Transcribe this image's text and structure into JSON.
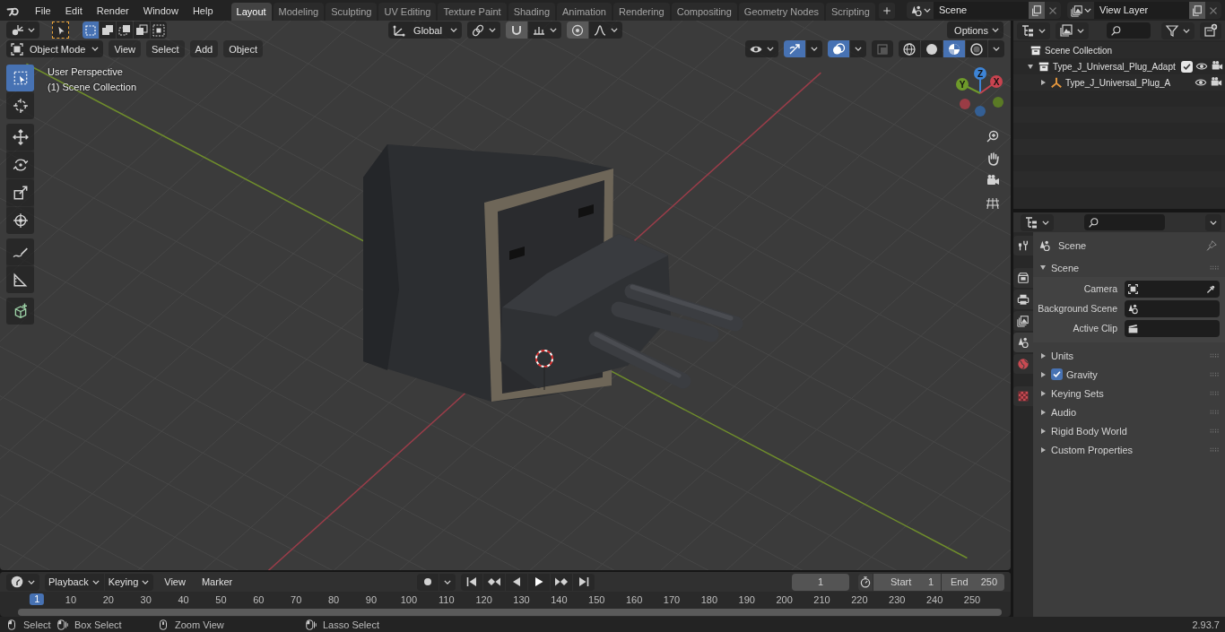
{
  "menu": [
    "File",
    "Edit",
    "Render",
    "Window",
    "Help"
  ],
  "workspaces": [
    {
      "label": "Layout",
      "selected": true
    },
    {
      "label": "Modeling",
      "selected": false
    },
    {
      "label": "Sculpting",
      "selected": false
    },
    {
      "label": "UV Editing",
      "selected": false
    },
    {
      "label": "Texture Paint",
      "selected": false
    },
    {
      "label": "Shading",
      "selected": false
    },
    {
      "label": "Animation",
      "selected": false
    },
    {
      "label": "Rendering",
      "selected": false
    },
    {
      "label": "Compositing",
      "selected": false
    },
    {
      "label": "Geometry Nodes",
      "selected": false
    },
    {
      "label": "Scripting",
      "selected": false
    }
  ],
  "scene_selector": {
    "value": "Scene"
  },
  "view_layer_selector": {
    "value": "View Layer"
  },
  "viewport": {
    "select_modes": [
      {
        "selected": true
      },
      {
        "selected": false
      },
      {
        "selected": false
      },
      {
        "selected": false
      },
      {
        "selected": false
      }
    ],
    "transform_orientation": "Global",
    "options": "Options",
    "mode": "Object Mode",
    "menus": [
      "View",
      "Select",
      "Add",
      "Object"
    ],
    "overlay_lines": [
      "User Perspective",
      "(1) Scene Collection"
    ],
    "tool_groups": [
      [
        {
          "kind": "select",
          "selected": true
        },
        {
          "kind": "cursor",
          "selected": false
        }
      ],
      [
        {
          "kind": "move",
          "selected": false
        },
        {
          "kind": "rotate",
          "selected": false
        },
        {
          "kind": "scale",
          "selected": false
        },
        {
          "kind": "transform",
          "selected": false
        }
      ],
      [
        {
          "kind": "annotate",
          "selected": false
        },
        {
          "kind": "measure",
          "selected": false
        }
      ],
      [
        {
          "kind": "add-cube",
          "selected": false
        }
      ]
    ],
    "gizmos_on": true,
    "overlays_on": true,
    "xray_on": false,
    "shading_modes": [
      {
        "kind": "wireframe",
        "selected": false
      },
      {
        "kind": "solid",
        "selected": false
      },
      {
        "kind": "material",
        "selected": true
      },
      {
        "kind": "rendered",
        "selected": false
      }
    ],
    "gizmo_axes": [
      {
        "label": "Z"
      },
      {
        "label": "Y"
      },
      {
        "label": "X"
      }
    ]
  },
  "outliner": {
    "root": "Scene Collection",
    "items": [
      {
        "label": "Type_J_Universal_Plug_Adapt",
        "kind": "collection",
        "expanded": true,
        "checked": true,
        "children": [
          {
            "label": "Type_J_Universal_Plug_A",
            "kind": "empty",
            "expanded": false
          }
        ]
      }
    ]
  },
  "properties": {
    "tabs": [
      {
        "kind": "tool",
        "selected": false
      },
      {
        "kind": "render",
        "selected": false
      },
      {
        "kind": "output",
        "selected": false
      },
      {
        "kind": "view-layer",
        "selected": false
      },
      {
        "kind": "scene",
        "selected": true
      },
      {
        "kind": "world",
        "selected": false
      },
      {
        "kind": "texture",
        "selected": false
      }
    ],
    "context": "Scene",
    "panels": [
      {
        "title": "Scene",
        "expanded": true,
        "fields": [
          {
            "label": "Camera",
            "kind": "camera"
          },
          {
            "label": "Background Scene",
            "kind": "scene"
          },
          {
            "label": "Active Clip",
            "kind": "clip"
          }
        ]
      },
      {
        "title": "Units",
        "expanded": false
      },
      {
        "title": "Gravity",
        "expanded": false,
        "checked": true
      },
      {
        "title": "Keying Sets",
        "expanded": false
      },
      {
        "title": "Audio",
        "expanded": false
      },
      {
        "title": "Rigid Body World",
        "expanded": false
      },
      {
        "title": "Custom Properties",
        "expanded": false
      }
    ]
  },
  "timeline": {
    "menus": [
      {
        "label": "Playback",
        "kind": "dropdown"
      },
      {
        "label": "Keying",
        "kind": "dropdown"
      },
      {
        "label": "View",
        "kind": "menu"
      },
      {
        "label": "Marker",
        "kind": "menu"
      }
    ],
    "current_frame": "1",
    "start_label": "Start",
    "start": "1",
    "end_label": "End",
    "end": "250",
    "ruler": [
      {
        "label": "1",
        "selected": true
      },
      {
        "label": "10",
        "selected": false
      },
      {
        "label": "20",
        "selected": false
      },
      {
        "label": "30",
        "selected": false
      },
      {
        "label": "40",
        "selected": false
      },
      {
        "label": "50",
        "selected": false
      },
      {
        "label": "60",
        "selected": false
      },
      {
        "label": "70",
        "selected": false
      },
      {
        "label": "80",
        "selected": false
      },
      {
        "label": "90",
        "selected": false
      },
      {
        "label": "100",
        "selected": false
      },
      {
        "label": "110",
        "selected": false
      },
      {
        "label": "120",
        "selected": false
      },
      {
        "label": "130",
        "selected": false
      },
      {
        "label": "140",
        "selected": false
      },
      {
        "label": "150",
        "selected": false
      },
      {
        "label": "160",
        "selected": false
      },
      {
        "label": "170",
        "selected": false
      },
      {
        "label": "180",
        "selected": false
      },
      {
        "label": "190",
        "selected": false
      },
      {
        "label": "200",
        "selected": false
      },
      {
        "label": "210",
        "selected": false
      },
      {
        "label": "220",
        "selected": false
      },
      {
        "label": "230",
        "selected": false
      },
      {
        "label": "240",
        "selected": false
      },
      {
        "label": "250",
        "selected": false
      }
    ]
  },
  "status_bar": {
    "hints": [
      {
        "kind": "mouse-left",
        "label": "Select"
      },
      {
        "kind": "mouse-drag",
        "label": "Box Select"
      },
      {
        "kind": "mouse-middle",
        "label": "Zoom View"
      },
      {
        "kind": "mouse-drag",
        "label": "Lasso Select"
      }
    ],
    "version": "2.93.7"
  }
}
